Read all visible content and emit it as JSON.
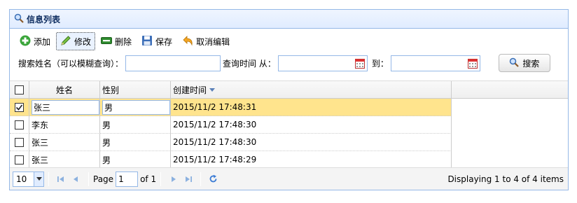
{
  "panel": {
    "title": "信息列表",
    "title_icon": "search-icon"
  },
  "toolbar": {
    "add_label": "添加",
    "edit_label": "修改",
    "delete_label": "删除",
    "save_label": "保存",
    "cancel_label": "取消编辑"
  },
  "search": {
    "name_label": "搜索姓名（可以模糊查询）：",
    "name_value": "",
    "time_label": "查询时间 从：",
    "from_value": "",
    "to_label": "到：",
    "to_value": "",
    "button_label": "搜索"
  },
  "grid": {
    "columns": [
      "姓名",
      "性别",
      "创建时间"
    ],
    "sort_indicator": "descending",
    "rows": [
      {
        "name": "张三",
        "sex": "男",
        "time": "2015/11/2 17:48:31",
        "checked": true
      },
      {
        "name": "李东",
        "sex": "男",
        "time": "2015/11/2 17:48:30",
        "checked": false
      },
      {
        "name": "张三",
        "sex": "男",
        "time": "2015/11/2 17:48:30",
        "checked": false
      },
      {
        "name": "张三",
        "sex": "男",
        "time": "2015/11/2 17:48:29",
        "checked": false
      }
    ]
  },
  "pager": {
    "page_size": "10",
    "page_label": "Page",
    "page_value": "1",
    "of_label": "of 1",
    "display_text": "Displaying 1 to 4 of 4 items"
  },
  "colors": {
    "border": "#95b8e7",
    "selected_row": "#ffe48d",
    "header_bg": "#e0ecff"
  }
}
